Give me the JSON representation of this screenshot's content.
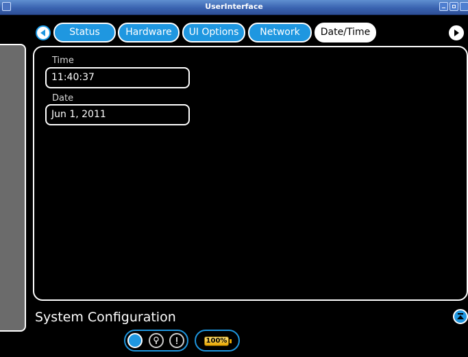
{
  "window": {
    "title": "UserInterface"
  },
  "tabs": [
    {
      "label": "Status"
    },
    {
      "label": "Hardware"
    },
    {
      "label": "UI Options"
    },
    {
      "label": "Network"
    },
    {
      "label": "Date/Time",
      "active": true
    }
  ],
  "fields": {
    "time": {
      "label": "Time",
      "value": "11:40:37"
    },
    "date": {
      "label": "Date",
      "value": "Jun 1, 2011"
    }
  },
  "footer": {
    "section_title": "System Configuration",
    "battery_text": "100%"
  },
  "colors": {
    "accent": "#1f97e0",
    "panel_bg": "#000000",
    "sidebar": "#6b6b6b",
    "battery": "#f0b400"
  },
  "icons": [
    "prev-arrow-icon",
    "next-arrow-icon",
    "scroll-top-icon",
    "lock-icon",
    "alert-icon",
    "battery-icon"
  ]
}
